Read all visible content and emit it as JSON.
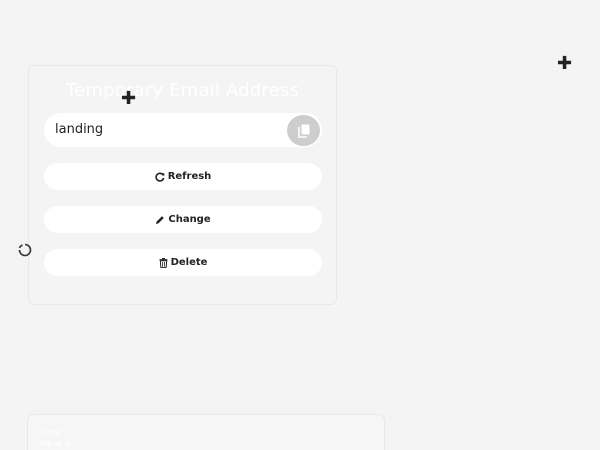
{
  "email_card": {
    "title": "Temporary Email Address",
    "email_value": "landing",
    "copy_icon": "copy-icon",
    "buttons": {
      "refresh": {
        "label": "Refresh",
        "icon": "refresh-icon"
      },
      "change": {
        "label": "Change",
        "icon": "pencil-icon"
      },
      "delete": {
        "label": "Delete",
        "icon": "trash-icon"
      }
    }
  },
  "decorations": {
    "plus_icon": "plus-icon",
    "spinner_icon": "spinner-icon"
  },
  "bottom_card": {
    "line1": "Inbox",
    "line2": "Inbox is"
  },
  "colors": {
    "background": "#f4f4f4",
    "button_bg": "#ffffff",
    "copy_button_bg": "#cdcdcd",
    "text": "#222222"
  }
}
